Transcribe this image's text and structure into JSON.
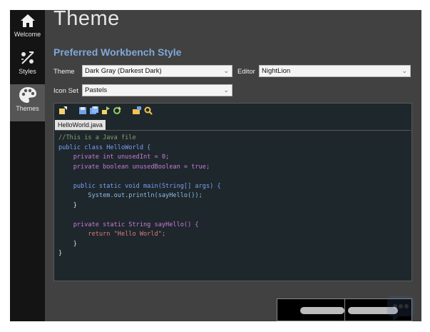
{
  "sidebar": {
    "items": [
      {
        "label": "Welcome",
        "icon": "home-icon",
        "active": false
      },
      {
        "label": "Styles",
        "icon": "styles-icon",
        "active": false
      },
      {
        "label": "Themes",
        "icon": "palette-icon",
        "active": true
      }
    ]
  },
  "page": {
    "title": "Theme",
    "section_title": "Preferred Workbench Style"
  },
  "form": {
    "theme_label": "Theme",
    "theme_value": "Dark Gray (Darkest Dark)",
    "editor_label": "Editor",
    "editor_value": "NightLion",
    "iconset_label": "Icon Set",
    "iconset_value": "Pastels"
  },
  "preview": {
    "toolbar_icons": [
      "new-file-icon",
      "save-icon",
      "save-all-icon",
      "export-icon",
      "refresh-icon",
      "open-folder-icon",
      "search-icon"
    ],
    "tab_label": "HelloWorld.java",
    "code_lines": [
      "//This is a Java file",
      "public class HelloWorld {",
      "    private int unusedInt = 0;",
      "    private boolean unusedBoolean = true;",
      "",
      "    public static void main(String[] args) {",
      "        System.out.println(sayHello());",
      "    }",
      "",
      "    private static String sayHello() {",
      "        return \"Hello World\";",
      "    }",
      "}"
    ]
  },
  "colors": {
    "window_bg": "#414141",
    "sidebar_bg": "#141414",
    "sidebar_active": "#555555",
    "section_title": "#7fa8d9",
    "editor_bg": "#1e272c"
  }
}
